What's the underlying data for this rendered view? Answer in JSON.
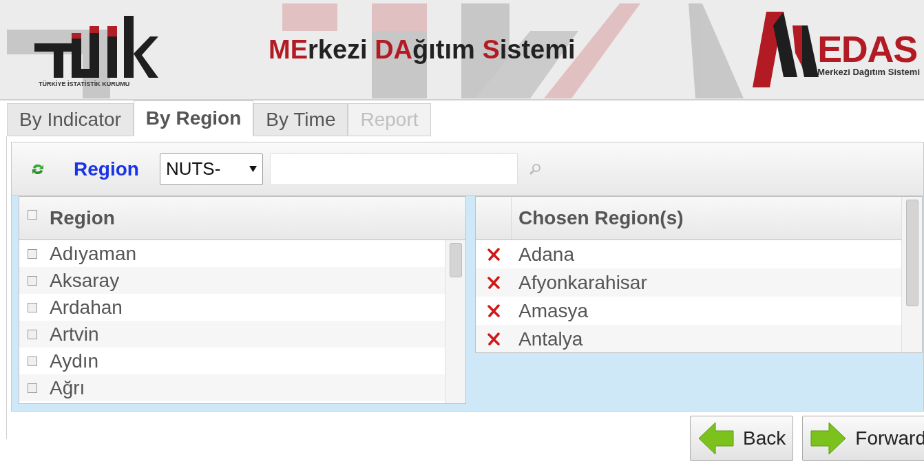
{
  "header": {
    "logo_caption": "TÜRKİYE İSTATİSTİK KURUMU",
    "title": [
      {
        "text": "ME",
        "accent": true
      },
      {
        "text": "rkezi ",
        "accent": false
      },
      {
        "text": "DA",
        "accent": true
      },
      {
        "text": "ğıtım ",
        "accent": false
      },
      {
        "text": "S",
        "accent": true
      },
      {
        "text": "istemi",
        "accent": false
      }
    ],
    "brand_letters": "EDAS",
    "brand_caption": "Merkezi Dağıtım Sistemi"
  },
  "tabs": [
    {
      "label": "By Indicator",
      "selected": false,
      "disabled": false
    },
    {
      "label": "By Region",
      "selected": true,
      "disabled": false
    },
    {
      "label": "By Time",
      "selected": false,
      "disabled": false
    },
    {
      "label": "Report",
      "selected": false,
      "disabled": true
    }
  ],
  "toolbar": {
    "label": "Region",
    "level_select": "NUTS-"
  },
  "region_list": {
    "header": "Region",
    "header_checked": false,
    "rows": [
      {
        "name": "Adıyaman",
        "checked": false
      },
      {
        "name": "Aksaray",
        "checked": false
      },
      {
        "name": "Ardahan",
        "checked": false
      },
      {
        "name": "Artvin",
        "checked": false
      },
      {
        "name": "Aydın",
        "checked": false
      },
      {
        "name": "Ağrı",
        "checked": false
      }
    ]
  },
  "chosen_list": {
    "header": "Chosen Region(s)",
    "rows": [
      "Adana",
      "Afyonkarahisar",
      "Amasya",
      "Antalya"
    ]
  },
  "buttons": [
    {
      "label": "Back",
      "kind": "back"
    },
    {
      "label": "Forward",
      "kind": "forward"
    }
  ]
}
